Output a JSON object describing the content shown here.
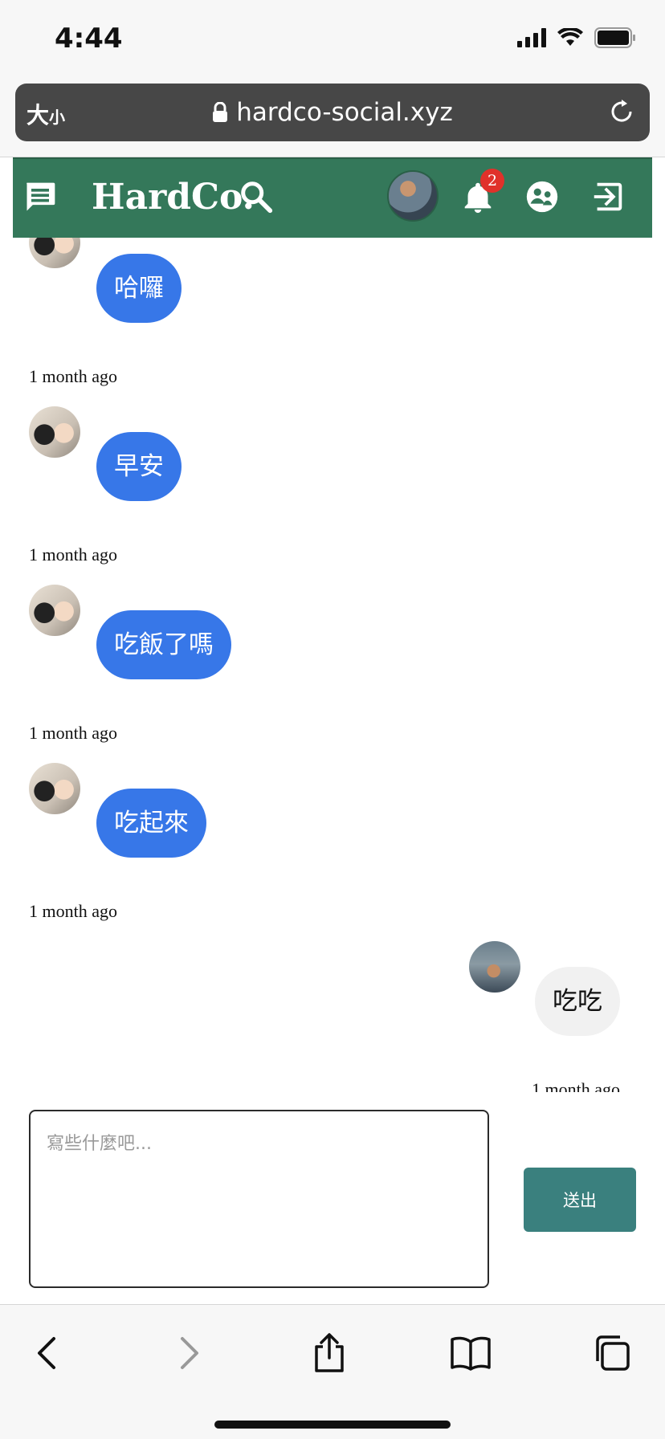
{
  "status_bar": {
    "time": "4:44"
  },
  "browser": {
    "text_size_label": "大",
    "text_size_small": "小",
    "url": "hardco-social.xyz"
  },
  "nav": {
    "brand": "HardCo.",
    "notification_count": "2"
  },
  "messages": [
    {
      "text": "哈囉",
      "timestamp": "1 month ago",
      "from": "other"
    },
    {
      "text": "早安",
      "timestamp": "1 month ago",
      "from": "other"
    },
    {
      "text": "吃飯了嗎",
      "timestamp": "1 month ago",
      "from": "other"
    },
    {
      "text": "吃起來",
      "timestamp": "1 month ago",
      "from": "other"
    },
    {
      "text": "吃吃",
      "timestamp": "1 month ago",
      "from": "me"
    }
  ],
  "composer": {
    "placeholder": "寫些什麼吧...",
    "value": "",
    "send_label": "送出"
  },
  "colors": {
    "nav_green": "#34785a",
    "incoming_bubble": "#3777e8",
    "outgoing_bubble": "#f1f1f1",
    "send_button": "#3a807e",
    "badge_red": "#e0312a"
  },
  "icons": [
    "chat-icon",
    "search-icon",
    "bell-icon",
    "groups-icon",
    "logout-icon",
    "lock-icon",
    "reload-icon",
    "back-icon",
    "forward-icon",
    "share-icon",
    "bookmarks-icon",
    "tabs-icon"
  ]
}
